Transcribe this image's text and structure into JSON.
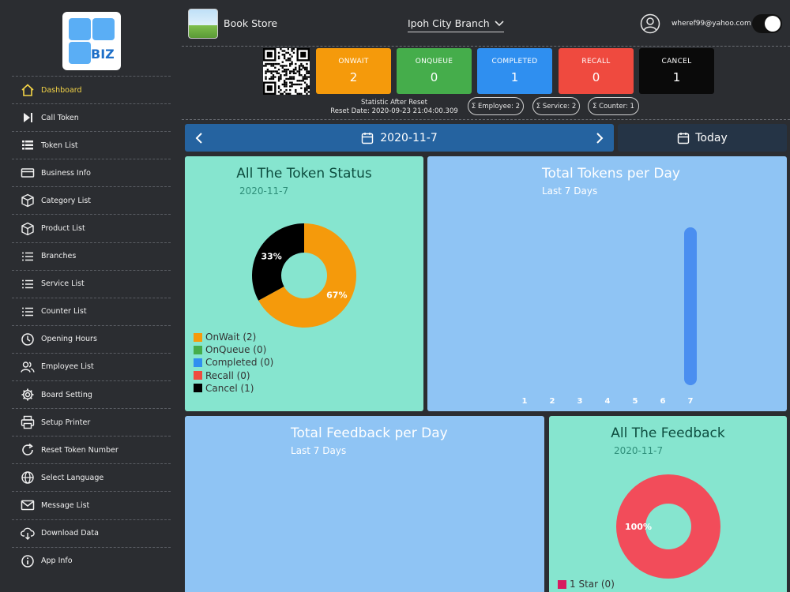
{
  "logo": {
    "text": "BIZ"
  },
  "sidebar": {
    "items": [
      {
        "label": "Dashboard",
        "icon": "home-icon",
        "active": true
      },
      {
        "label": "Call Token",
        "icon": "skip-forward-icon"
      },
      {
        "label": "Token List",
        "icon": "list-icon"
      },
      {
        "label": "Business Info",
        "icon": "card-icon"
      },
      {
        "label": "Category List",
        "icon": "cube-icon"
      },
      {
        "label": "Product List",
        "icon": "cube-icon"
      },
      {
        "label": "Branches",
        "icon": "bullet-list-icon"
      },
      {
        "label": "Service List",
        "icon": "bullet-list-icon"
      },
      {
        "label": "Counter List",
        "icon": "bullet-list-icon"
      },
      {
        "label": "Opening Hours",
        "icon": "clock-icon"
      },
      {
        "label": "Employee List",
        "icon": "users-icon"
      },
      {
        "label": "Board Setting",
        "icon": "gear-icon"
      },
      {
        "label": "Setup Printer",
        "icon": "printer-icon"
      },
      {
        "label": "Reset Token Number",
        "icon": "refresh-icon"
      },
      {
        "label": "Select Language",
        "icon": "globe-icon"
      },
      {
        "label": "Message List",
        "icon": "mail-icon"
      },
      {
        "label": "Download Data",
        "icon": "download-icon"
      },
      {
        "label": "App Info",
        "icon": "info-icon"
      }
    ]
  },
  "header": {
    "store_name": "Book Store",
    "branch": "Ipoh City Branch",
    "email": "wheref99@yahoo.com"
  },
  "stats": [
    {
      "label": "ONWAIT",
      "value": "2",
      "color": "#f59a0b"
    },
    {
      "label": "ONQUEUE",
      "value": "0",
      "color": "#45ad4b"
    },
    {
      "label": "COMPLETED",
      "value": "1",
      "color": "#2f8ff0"
    },
    {
      "label": "RECALL",
      "value": "0",
      "color": "#ef4a3f"
    },
    {
      "label": "CANCEL",
      "value": "1",
      "color": "#0a0a0a"
    }
  ],
  "reset_info": {
    "line1": "Statistic After Reset",
    "line2": "Reset Date: 2020-09-23 21:04:00.309"
  },
  "pills": {
    "employee": "Σ Employee: 2",
    "service": "Σ Service: 2",
    "counter": "Σ Counter: 1"
  },
  "date_bar": {
    "date": "2020-11-7",
    "today": "Today"
  },
  "token_status": {
    "title": "All The Token Status",
    "date": "2020-11-7",
    "legend": [
      {
        "label": "OnWait (2)",
        "color": "#f59a0b"
      },
      {
        "label": "OnQueue (0)",
        "color": "#45ad4b"
      },
      {
        "label": "Completed (0)",
        "color": "#2f8ff0"
      },
      {
        "label": "Recall (0)",
        "color": "#ef4a3f"
      },
      {
        "label": "Cancel (1)",
        "color": "#000000"
      }
    ],
    "slices": [
      {
        "value": 67,
        "label": "67%",
        "color": "#f59a0b"
      },
      {
        "value": 33,
        "label": "33%",
        "color": "#000000"
      }
    ]
  },
  "tokens_per_day": {
    "title": "Total Tokens per Day",
    "subtitle": "Last 7 Days",
    "x": [
      "1",
      "2",
      "3",
      "4",
      "5",
      "6",
      "7"
    ],
    "values": [
      0,
      0,
      0,
      0,
      0,
      0,
      1
    ],
    "bar_color": "#4a8ef0"
  },
  "feedback_per_day": {
    "title": "Total Feedback per Day",
    "subtitle": "Last 7 Days"
  },
  "all_feedback": {
    "title": "All The Feedback",
    "date": "2020-11-7",
    "slices": [
      {
        "value": 100,
        "label": "100%",
        "color": "#f24c5a"
      }
    ],
    "legend": [
      {
        "label": "1 Star (0)",
        "color": "#d81b60"
      }
    ]
  }
}
